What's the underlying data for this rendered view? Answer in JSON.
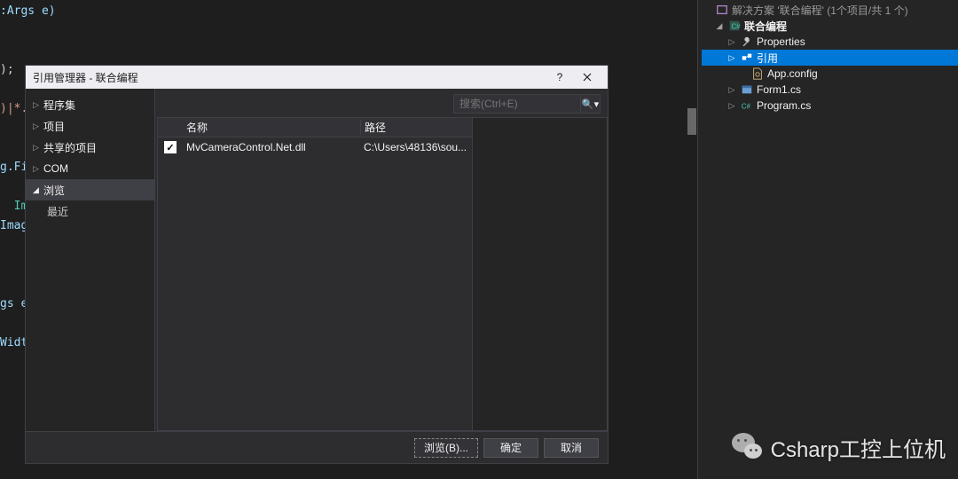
{
  "code_fragments": {
    "l1": ":Args e)",
    "l2": ");",
    "l3": ")|*.j",
    "l4": "g.Fil",
    "l5a": "  Imag",
    "l5b": "Image_",
    "l6": "gs e)",
    "l7": "Width,"
  },
  "dialog": {
    "title": "引用管理器 - 联合编程",
    "help": "?",
    "sidebar": {
      "items": [
        {
          "label": "程序集",
          "arrow": "▷"
        },
        {
          "label": "项目",
          "arrow": "▷"
        },
        {
          "label": "共享的项目",
          "arrow": "▷"
        },
        {
          "label": "COM",
          "arrow": "▷"
        },
        {
          "label": "浏览",
          "arrow": "◢",
          "expanded": true
        }
      ],
      "sub": "最近"
    },
    "search": {
      "placeholder": "搜索(Ctrl+E)",
      "icon": "🔍"
    },
    "columns": {
      "name": "名称",
      "path": "路径"
    },
    "rows": [
      {
        "checked": true,
        "name": "MvCameraControl.Net.dll",
        "path": "C:\\Users\\48136\\sou..."
      }
    ],
    "buttons": {
      "browse": "浏览(B)...",
      "ok": "确定",
      "cancel": "取消"
    }
  },
  "solution": {
    "header": "解决方案 '联合编程' (1个项目/共 1 个)",
    "project": "联合编程",
    "nodes": {
      "properties": "Properties",
      "references": "引用",
      "appconfig": "App.config",
      "form1": "Form1.cs",
      "program": "Program.cs"
    }
  },
  "watermark": "Csharp工控上位机"
}
